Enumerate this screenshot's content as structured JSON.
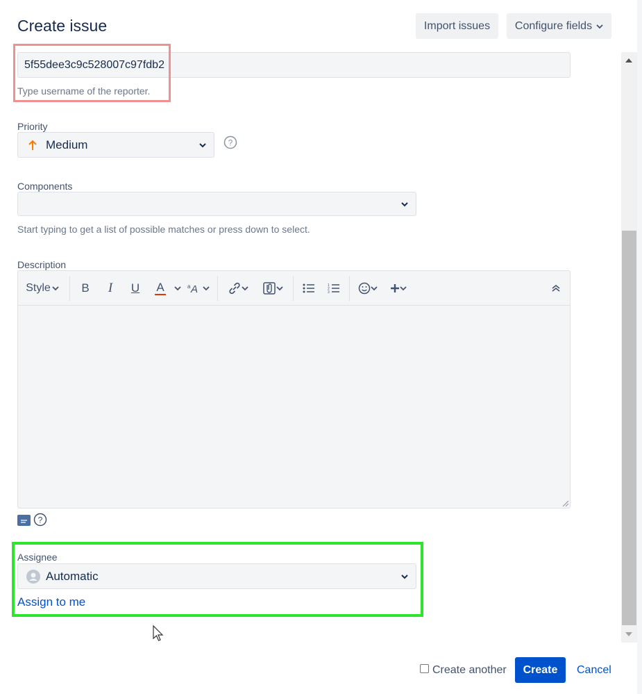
{
  "dialog": {
    "title": "Create issue",
    "import_label": "Import issues",
    "configure_label": "Configure fields"
  },
  "reporter": {
    "value": "5f55dee3c9c528007c97fdb2",
    "hint": "Type username of the reporter."
  },
  "priority": {
    "label": "Priority",
    "value": "Medium",
    "icon": "arrow-up-icon",
    "icon_color": "#ff7a00"
  },
  "components": {
    "label": "Components",
    "value": "",
    "hint": "Start typing to get a list of possible matches or press down to select."
  },
  "description": {
    "label": "Description",
    "toolbar": {
      "style_label": "Style",
      "bold": "B",
      "italic": "I",
      "underline": "U",
      "text_color": "A"
    }
  },
  "assignee": {
    "label": "Assignee",
    "value": "Automatic",
    "assign_to_me": "Assign to me"
  },
  "footer": {
    "create_another": "Create another",
    "create_label": "Create",
    "cancel_label": "Cancel"
  },
  "colors": {
    "accent": "#0052cc",
    "highlight_red": "#f09191",
    "highlight_green": "#2ee52e"
  }
}
